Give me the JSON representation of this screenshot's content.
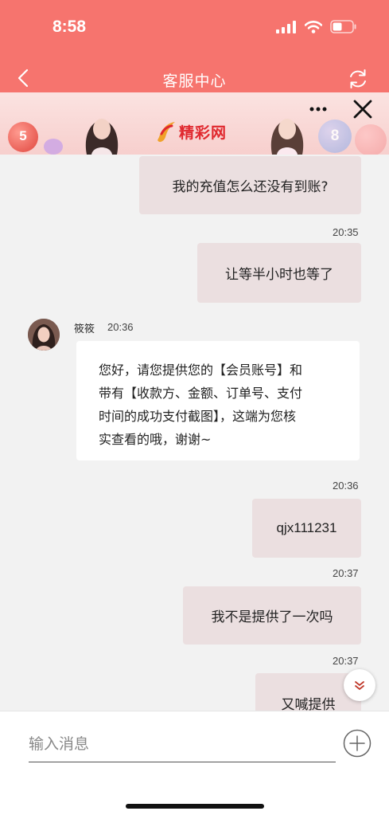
{
  "status_bar": {
    "time": "8:58"
  },
  "nav": {
    "title": "客服中心"
  },
  "banner": {
    "logo_text": "精彩网",
    "balls": [
      "5",
      "8"
    ]
  },
  "messages": [
    {
      "direction": "out",
      "text": "我的充值怎么还没有到账?"
    },
    {
      "timestamp": "20:35"
    },
    {
      "direction": "out",
      "text": "让等半小时也等了"
    },
    {
      "direction": "in",
      "sender": "筱筱",
      "time": "20:36",
      "lines": [
        "您好，请您提供您的【会员账号】和",
        "带有【收款方、金额、订单号、支付",
        "时间的成功支付截图】，这端为您核",
        "实查看的哦，谢谢~"
      ]
    },
    {
      "timestamp": "20:36"
    },
    {
      "direction": "out",
      "text": "qjx111231"
    },
    {
      "timestamp": "20:37"
    },
    {
      "direction": "out",
      "text": "我不是提供了一次吗"
    },
    {
      "timestamp": "20:37"
    },
    {
      "direction": "out",
      "text": "又喊提供"
    }
  ],
  "input": {
    "placeholder": "输入消息"
  },
  "colors": {
    "header": "#f6746e",
    "bubble_out": "#ebdfe0",
    "bubble_in": "#ffffff",
    "background": "#f2f2f2"
  }
}
